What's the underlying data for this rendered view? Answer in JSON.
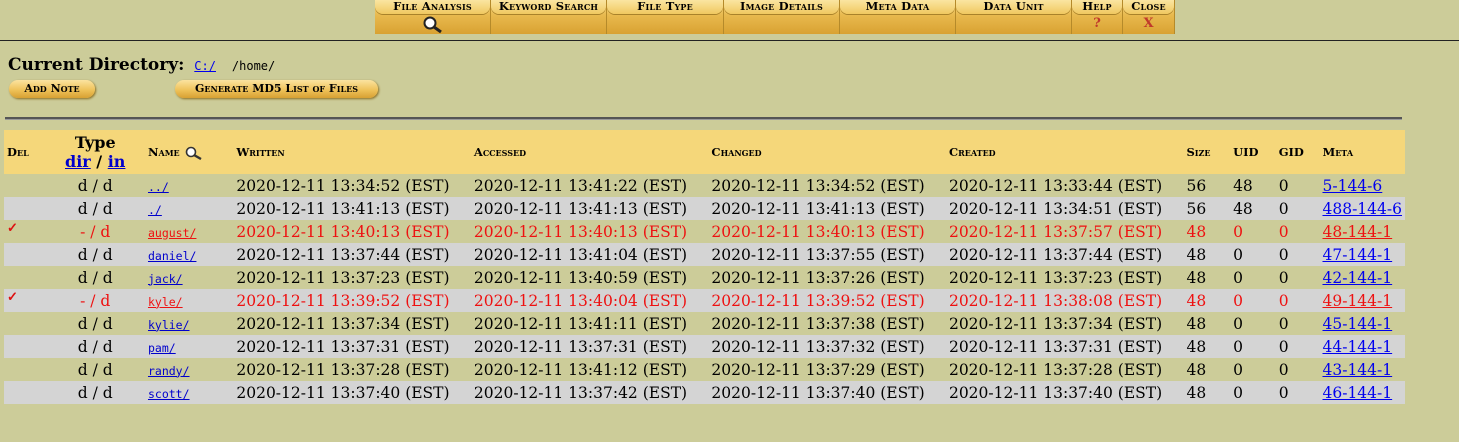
{
  "toolbar": {
    "file_analysis": "File Analysis",
    "keyword_search": "Keyword Search",
    "file_type": "File Type",
    "image_details": "Image Details",
    "meta_data": "Meta Data",
    "data_unit": "Data Unit",
    "help": "Help",
    "help_sub": "?",
    "close": "Close",
    "close_sub": "X",
    "search_icon": "magnifier-icon"
  },
  "header": {
    "current_directory_label": "Current Directory:",
    "root_link": "C:/",
    "path": "/home/",
    "add_note": "Add Note",
    "generate_md5": "Generate MD5 List of Files"
  },
  "table": {
    "columns": {
      "del": "Del",
      "type": "Type",
      "type_dir": "dir",
      "type_sep": "/",
      "type_in": "in",
      "name": "Name",
      "written": "Written",
      "accessed": "Accessed",
      "changed": "Changed",
      "created": "Created",
      "size": "Size",
      "uid": "UID",
      "gid": "GID",
      "meta": "Meta"
    },
    "rows": [
      {
        "del": "",
        "type": "d / d",
        "name": "../",
        "written": "2020-12-11 13:34:52 (EST)",
        "accessed": "2020-12-11 13:41:22 (EST)",
        "changed": "2020-12-11 13:34:52 (EST)",
        "created": "2020-12-11 13:33:44 (EST)",
        "size": "56",
        "uid": "48",
        "gid": "0",
        "meta": "5-144-6",
        "deleted": false
      },
      {
        "del": "",
        "type": "d / d",
        "name": "./",
        "written": "2020-12-11 13:41:13 (EST)",
        "accessed": "2020-12-11 13:41:13 (EST)",
        "changed": "2020-12-11 13:41:13 (EST)",
        "created": "2020-12-11 13:34:51 (EST)",
        "size": "56",
        "uid": "48",
        "gid": "0",
        "meta": "488-144-6",
        "deleted": false
      },
      {
        "del": "✓",
        "type": "- / d",
        "name": "august/",
        "written": "2020-12-11 13:40:13 (EST)",
        "accessed": "2020-12-11 13:40:13 (EST)",
        "changed": "2020-12-11 13:40:13 (EST)",
        "created": "2020-12-11 13:37:57 (EST)",
        "size": "48",
        "uid": "0",
        "gid": "0",
        "meta": "48-144-1",
        "deleted": true
      },
      {
        "del": "",
        "type": "d / d",
        "name": "daniel/",
        "written": "2020-12-11 13:37:44 (EST)",
        "accessed": "2020-12-11 13:41:04 (EST)",
        "changed": "2020-12-11 13:37:55 (EST)",
        "created": "2020-12-11 13:37:44 (EST)",
        "size": "48",
        "uid": "0",
        "gid": "0",
        "meta": "47-144-1",
        "deleted": false
      },
      {
        "del": "",
        "type": "d / d",
        "name": "jack/",
        "written": "2020-12-11 13:37:23 (EST)",
        "accessed": "2020-12-11 13:40:59 (EST)",
        "changed": "2020-12-11 13:37:26 (EST)",
        "created": "2020-12-11 13:37:23 (EST)",
        "size": "48",
        "uid": "0",
        "gid": "0",
        "meta": "42-144-1",
        "deleted": false
      },
      {
        "del": "✓",
        "type": "- / d",
        "name": "kyle/",
        "written": "2020-12-11 13:39:52 (EST)",
        "accessed": "2020-12-11 13:40:04 (EST)",
        "changed": "2020-12-11 13:39:52 (EST)",
        "created": "2020-12-11 13:38:08 (EST)",
        "size": "48",
        "uid": "0",
        "gid": "0",
        "meta": "49-144-1",
        "deleted": true
      },
      {
        "del": "",
        "type": "d / d",
        "name": "kylie/",
        "written": "2020-12-11 13:37:34 (EST)",
        "accessed": "2020-12-11 13:41:11 (EST)",
        "changed": "2020-12-11 13:37:38 (EST)",
        "created": "2020-12-11 13:37:34 (EST)",
        "size": "48",
        "uid": "0",
        "gid": "0",
        "meta": "45-144-1",
        "deleted": false
      },
      {
        "del": "",
        "type": "d / d",
        "name": "pam/",
        "written": "2020-12-11 13:37:31 (EST)",
        "accessed": "2020-12-11 13:37:31 (EST)",
        "changed": "2020-12-11 13:37:32 (EST)",
        "created": "2020-12-11 13:37:31 (EST)",
        "size": "48",
        "uid": "0",
        "gid": "0",
        "meta": "44-144-1",
        "deleted": false
      },
      {
        "del": "",
        "type": "d / d",
        "name": "randy/",
        "written": "2020-12-11 13:37:28 (EST)",
        "accessed": "2020-12-11 13:41:12 (EST)",
        "changed": "2020-12-11 13:37:29 (EST)",
        "created": "2020-12-11 13:37:28 (EST)",
        "size": "48",
        "uid": "0",
        "gid": "0",
        "meta": "43-144-1",
        "deleted": false
      },
      {
        "del": "",
        "type": "d / d",
        "name": "scott/",
        "written": "2020-12-11 13:37:40 (EST)",
        "accessed": "2020-12-11 13:37:42 (EST)",
        "changed": "2020-12-11 13:37:40 (EST)",
        "created": "2020-12-11 13:37:40 (EST)",
        "size": "48",
        "uid": "0",
        "gid": "0",
        "meta": "46-144-1",
        "deleted": false
      }
    ]
  },
  "colors": {
    "background": "#cccc99",
    "header_row": "#f5d77a",
    "alt_row": "#d4d4d4",
    "deleted_text": "#ee1111",
    "link": "#0000cc"
  }
}
